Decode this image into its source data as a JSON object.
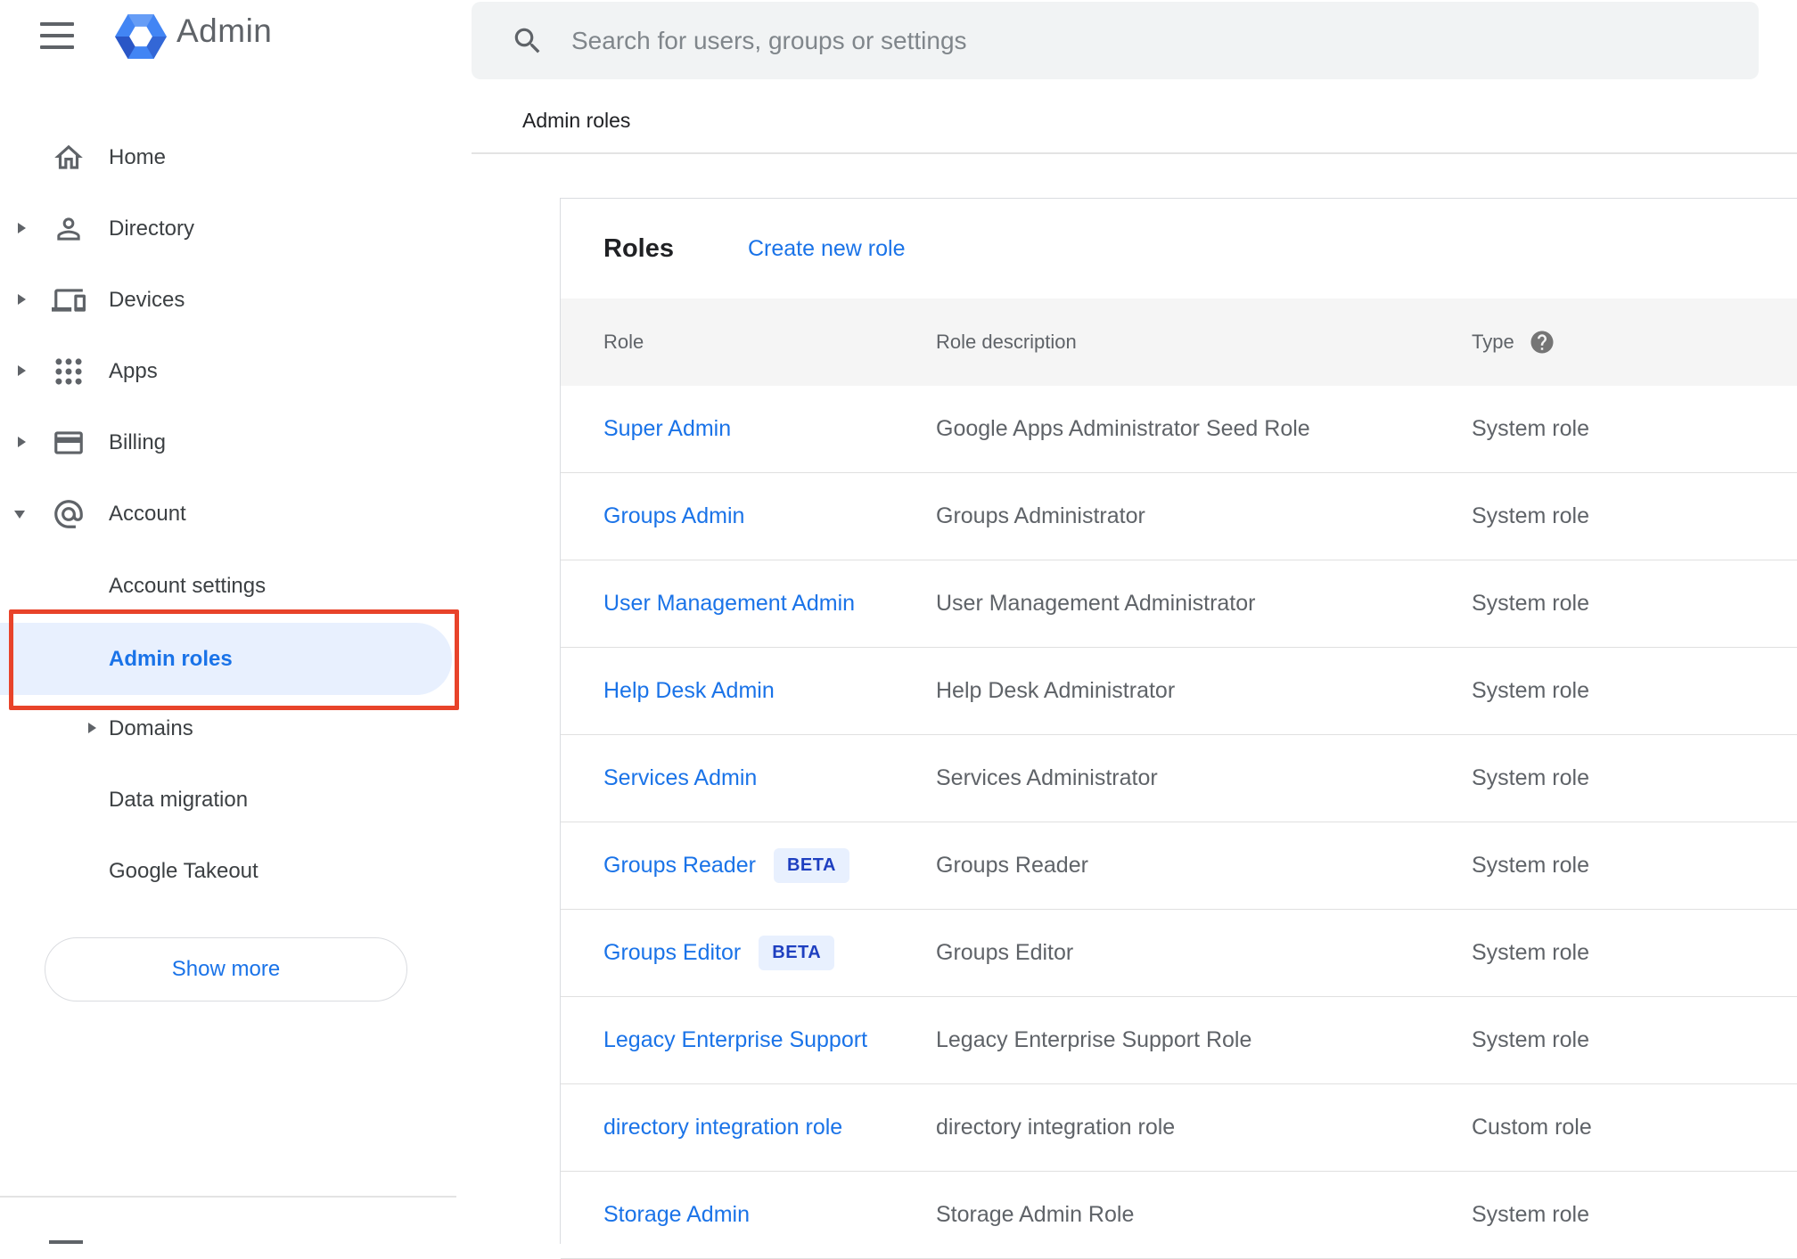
{
  "app": {
    "logo_text": "Admin"
  },
  "search": {
    "placeholder": "Search for users, groups or settings"
  },
  "breadcrumb": "Admin roles",
  "sidebar": {
    "items": [
      {
        "label": "Home"
      },
      {
        "label": "Directory"
      },
      {
        "label": "Devices"
      },
      {
        "label": "Apps"
      },
      {
        "label": "Billing"
      },
      {
        "label": "Account"
      }
    ],
    "account_subitems": [
      {
        "label": "Account settings"
      },
      {
        "label": "Admin roles",
        "selected": true
      },
      {
        "label": "Domains"
      },
      {
        "label": "Data migration"
      },
      {
        "label": "Google Takeout"
      }
    ],
    "show_more_label": "Show more"
  },
  "main": {
    "card_title": "Roles",
    "create_link": "Create new role",
    "table": {
      "columns": [
        "Role",
        "Role description",
        "Type"
      ],
      "rows": [
        {
          "role": "Super Admin",
          "description": "Google Apps Administrator Seed Role",
          "type": "System role"
        },
        {
          "role": "Groups Admin",
          "description": "Groups Administrator",
          "type": "System role"
        },
        {
          "role": "User Management Admin",
          "description": "User Management Administrator",
          "type": "System role"
        },
        {
          "role": "Help Desk Admin",
          "description": "Help Desk Administrator",
          "type": "System role"
        },
        {
          "role": "Services Admin",
          "description": "Services Administrator",
          "type": "System role"
        },
        {
          "role": "Groups Reader",
          "beta_label": "BETA",
          "description": "Groups Reader",
          "type": "System role"
        },
        {
          "role": "Groups Editor",
          "beta_label": "BETA",
          "description": "Groups Editor",
          "type": "System role"
        },
        {
          "role": "Legacy Enterprise Support",
          "description": "Legacy Enterprise Support Role",
          "type": "System role"
        },
        {
          "role": "directory integration role",
          "description": "directory integration role",
          "type": "Custom role"
        },
        {
          "role": "Storage Admin",
          "description": "Storage Admin Role",
          "type": "System role"
        }
      ]
    }
  },
  "colors": {
    "accent_blue": "#1a73e8",
    "annotation_red": "#e8432a",
    "selected_bg": "#e8f0fe",
    "beta_bg": "#e8f0fe",
    "beta_text": "#1e3fc0",
    "header_gray": "#f5f5f5"
  }
}
